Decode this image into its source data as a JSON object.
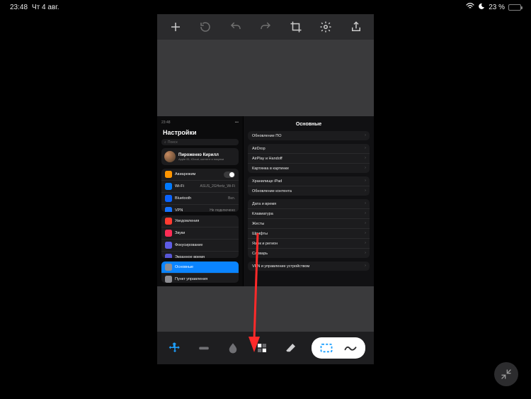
{
  "status": {
    "time": "23:48",
    "date": "Чт 4 авг.",
    "battery": "23 %"
  },
  "inner_status": {
    "nettime": "23:48"
  },
  "sidebar": {
    "title": "Настройки",
    "search": "Поиск",
    "profile": {
      "name": "Пироженко Кирилл",
      "sub": "Apple ID, iCloud, контент и покупки"
    },
    "group1": [
      {
        "label": "Авиарежим",
        "trail": "toggle"
      },
      {
        "label": "Wi-Fi",
        "trail": "ASUS_2GHertz_Wi-Fi"
      },
      {
        "label": "Bluetooth",
        "trail": "Вкл."
      },
      {
        "label": "VPN",
        "trail": "Не подключено"
      }
    ],
    "group2": [
      {
        "label": "Уведомления"
      },
      {
        "label": "Звуки"
      },
      {
        "label": "Фокусирование"
      },
      {
        "label": "Экранное время"
      }
    ],
    "group3": [
      {
        "label": "Основные",
        "selected": true
      },
      {
        "label": "Пункт управления"
      }
    ]
  },
  "detail": {
    "title": "Основные",
    "b1": [
      "Обновление ПО"
    ],
    "b2": [
      "AirDrop",
      "AirPlay и Handoff",
      "Картинка в картинке"
    ],
    "b3": [
      "Хранилище iPad",
      "Обновление контента"
    ],
    "b4": [
      "Дата и время",
      "Клавиатура",
      "Жесты",
      "Шрифты",
      "Язык и регион",
      "Словарь"
    ],
    "b5": [
      "VPN и управление устройством"
    ]
  }
}
